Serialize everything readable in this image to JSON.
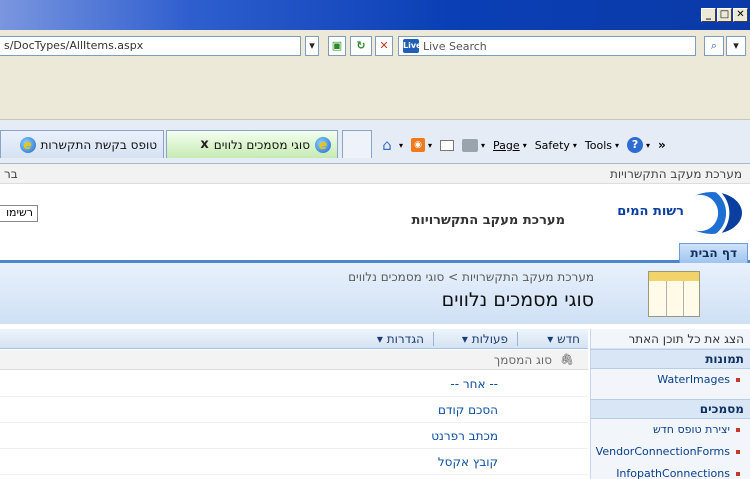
{
  "window": {
    "buttons": [
      "_",
      "□",
      "✕"
    ]
  },
  "address": {
    "url": "s/DocTypes/AllItems.aspx",
    "search_placeholder": "Live Search",
    "search_logo": "Live"
  },
  "tabs": [
    {
      "label": "טופס בקשת התקשרות"
    },
    {
      "label": "סוגי מסמכים נלווים",
      "close": "x"
    }
  ],
  "command_bar": {
    "page": "Page",
    "safety": "Safety",
    "tools": "Tools",
    "more": "»"
  },
  "site": {
    "breadcrumb_top": "מערכת מעקב התקשרויות",
    "top_left": "בר",
    "logo_text": "רשות המים",
    "site_title": "מערכת מעקב התקשרויות",
    "view_button": "רשימו",
    "home_tab": "דף הבית",
    "crumb": "מערכת מעקב התקשרויות > סוגי מסמכים נלווים",
    "list_title": "סוגי מסמכים נלווים"
  },
  "quick_launch": {
    "view_all": "הצג את כל תוכן האתר",
    "sections": [
      {
        "title": "תמונות",
        "items": [
          "WaterImages"
        ]
      },
      {
        "title": "מסמכים",
        "items": [
          "יצירת טופס חדש",
          "VendorConnectionForms",
          "InfopathConnections"
        ]
      }
    ]
  },
  "toolbar": {
    "new": "חדש",
    "actions": "פעולות",
    "settings": "הגדרות",
    "caret": "▾"
  },
  "list": {
    "column": "סוג המסמך",
    "rows": [
      "-- אחר --",
      "הסכם קודם",
      "מכתב רפרנט",
      "קובץ אקסל"
    ]
  }
}
